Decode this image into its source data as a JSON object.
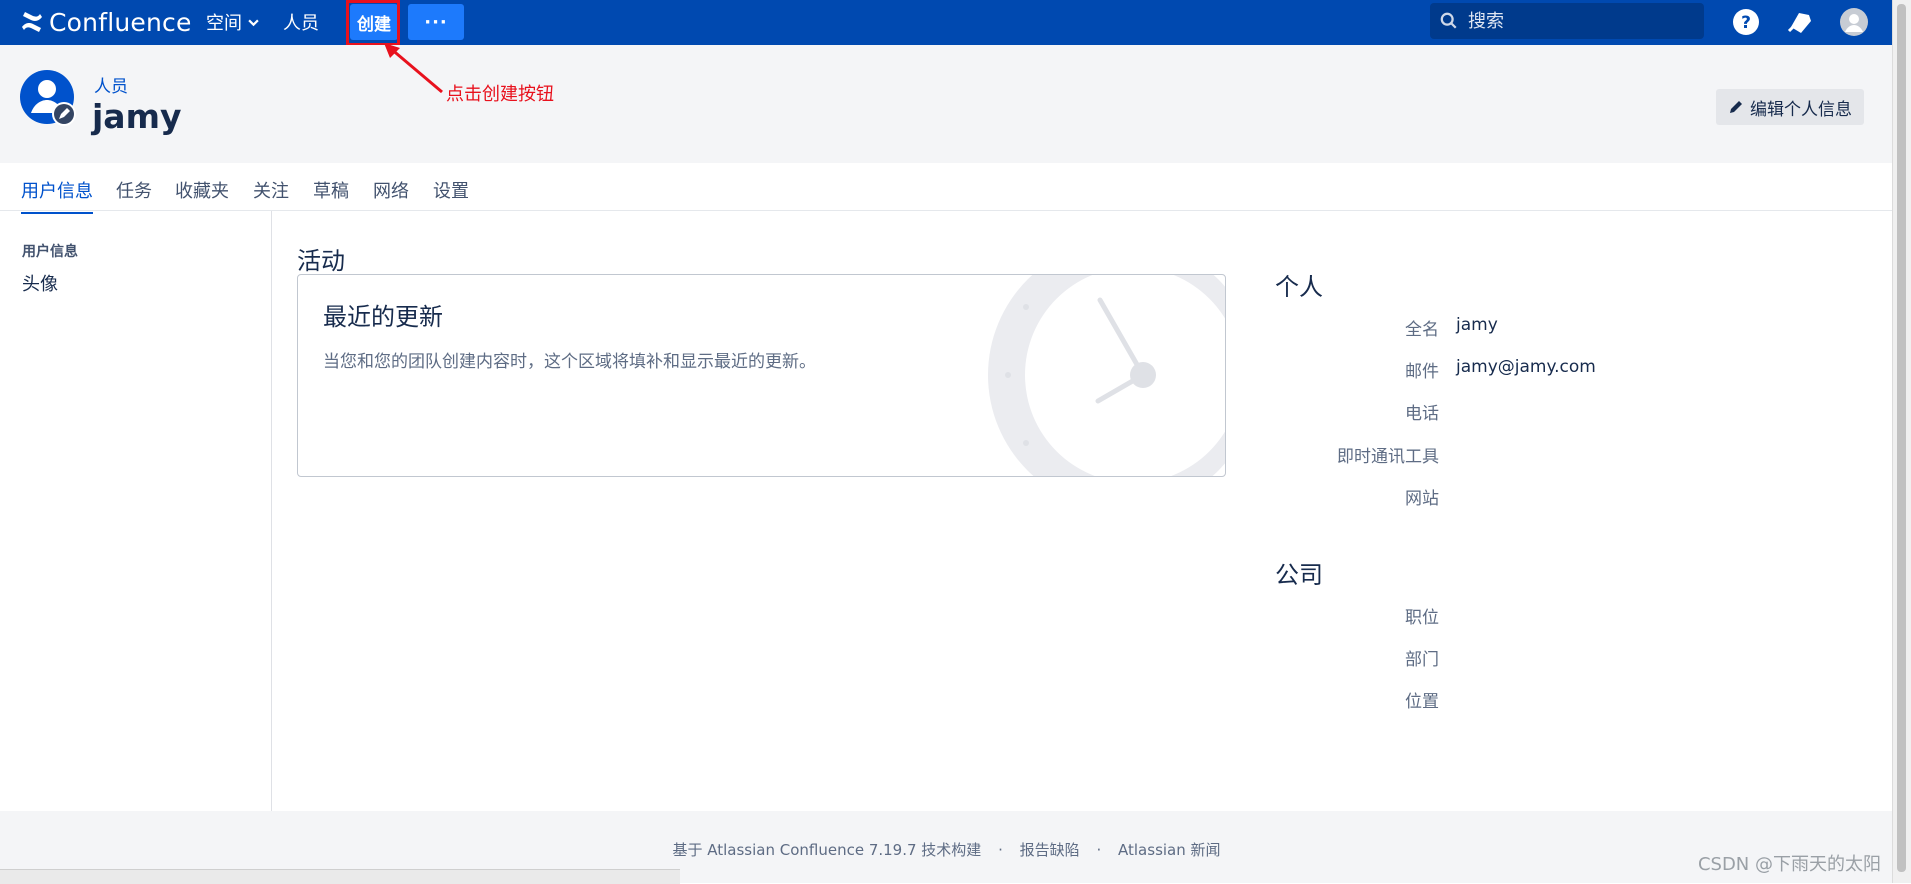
{
  "topnav": {
    "app_name": "Confluence",
    "spaces_label": "空间",
    "people_label": "人员",
    "create_label": "创建",
    "more_label": "···",
    "search_placeholder": "搜索",
    "background": "#0049b0",
    "create_color": "#1d7afc"
  },
  "header": {
    "breadcrumb": "人员",
    "username": "jamy",
    "edit_label": "编辑个人信息"
  },
  "annotation": {
    "text": "点击创建按钮",
    "color": "#e8111d"
  },
  "tabs": [
    "用户信息",
    "任务",
    "收藏夹",
    "关注",
    "草稿",
    "网络",
    "设置"
  ],
  "sidebar": {
    "heading": "用户信息",
    "items": [
      "头像"
    ]
  },
  "activity": {
    "section_title": "活动",
    "card_title": "最近的更新",
    "card_desc": "当您和您的团队创建内容时，这个区域将填补和显示最近的更新。"
  },
  "personal": {
    "title": "个人",
    "fields": [
      {
        "label": "全名",
        "value": "jamy"
      },
      {
        "label": "邮件",
        "value": "jamy@jamy.com"
      },
      {
        "label": "电话",
        "value": ""
      },
      {
        "label": "即时通讯工具",
        "value": ""
      },
      {
        "label": "网站",
        "value": ""
      }
    ]
  },
  "company": {
    "title": "公司",
    "fields": [
      {
        "label": "职位",
        "value": ""
      },
      {
        "label": "部门",
        "value": ""
      },
      {
        "label": "位置",
        "value": ""
      }
    ]
  },
  "footer": {
    "built_with": "基于 Atlassian Confluence 7.19.7 技术构建",
    "report_bug": "报告缺陷",
    "news": "Atlassian 新闻",
    "separator": "·"
  },
  "watermark": "CSDN @下雨天的太阳"
}
